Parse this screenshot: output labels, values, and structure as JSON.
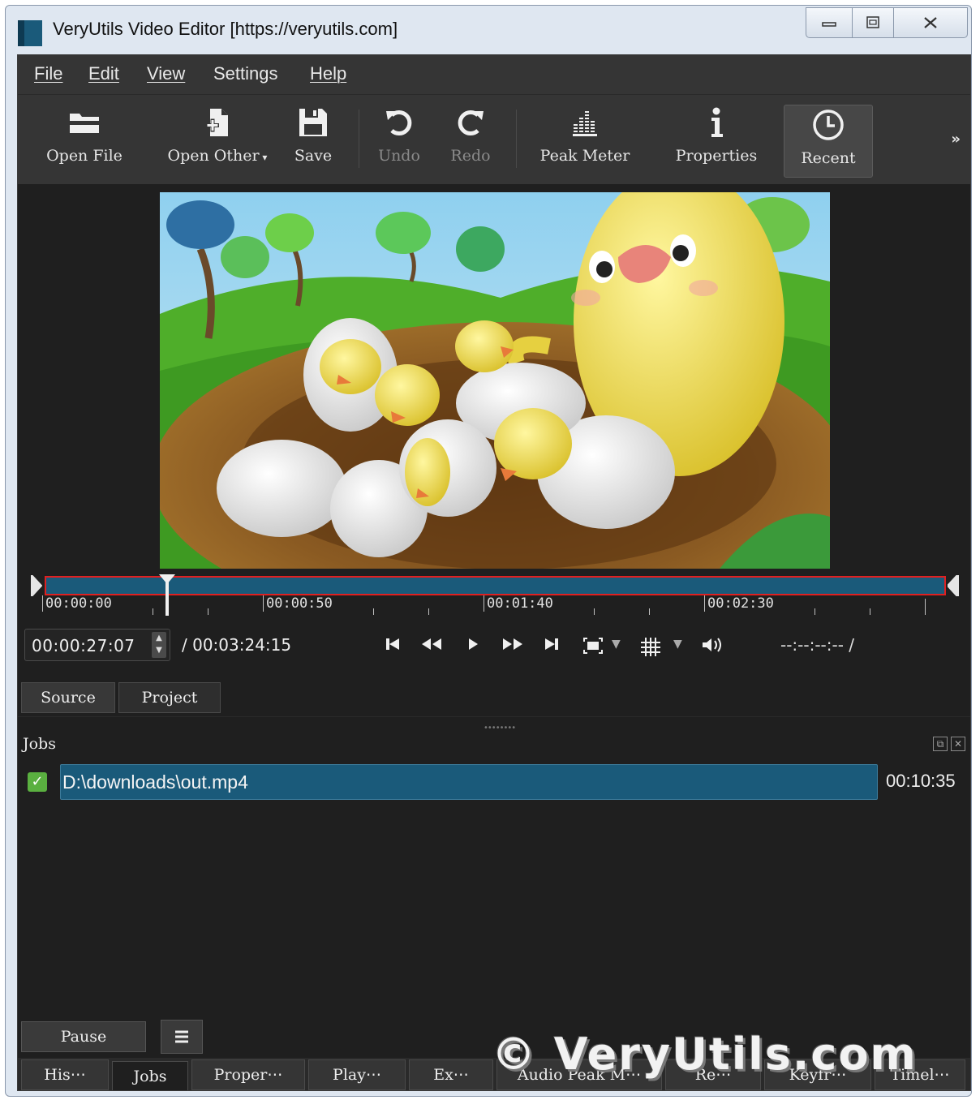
{
  "window": {
    "title": "VeryUtils Video Editor [https://veryutils.com]",
    "controls": [
      "minimize",
      "restore",
      "close"
    ]
  },
  "menu": {
    "items": [
      {
        "label": "File"
      },
      {
        "label": "Edit"
      },
      {
        "label": "View"
      },
      {
        "label": "Settings"
      },
      {
        "label": "Help"
      }
    ]
  },
  "toolbar": {
    "open_file": "Open File",
    "open_other": "Open Other",
    "save": "Save",
    "undo": "Undo",
    "redo": "Redo",
    "peak_meter": "Peak Meter",
    "properties": "Properties",
    "recent": "Recent",
    "more": "»"
  },
  "timeline": {
    "ticks": [
      "00:00:00",
      "00:00:50",
      "00:01:40",
      "00:02:30"
    ],
    "playhead_fraction": 0.135
  },
  "transport": {
    "current_time": "00:00:27:07",
    "total_time": "/ 00:03:24:15",
    "in_out": "--:--:--:-- /"
  },
  "panels": {
    "source_tab": "Source",
    "project_tab": "Project",
    "jobs_title": "Jobs"
  },
  "jobs": [
    {
      "name": "D:\\downloads\\out.mp4",
      "time": "00:10:35",
      "done": true
    }
  ],
  "bottom": {
    "pause": "Pause",
    "tabs": [
      "His⋯",
      "Jobs",
      "Proper⋯",
      "Play⋯",
      "Ex⋯",
      "Audio Peak M⋯",
      "Re⋯",
      "Keyfr⋯",
      "Timel⋯"
    ],
    "active_tab": "Jobs"
  },
  "watermark": "© VeryUtils.com",
  "colors": {
    "accent": "#1a5a7a",
    "scrub_border": "#e02020",
    "job_check": "#5ab040"
  }
}
